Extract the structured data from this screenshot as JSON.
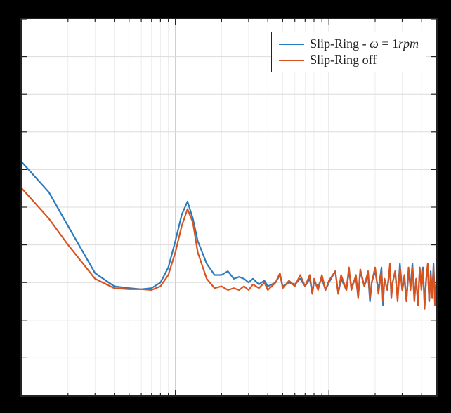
{
  "chart_data": {
    "type": "line",
    "xlabel": "",
    "ylabel": "",
    "xscale": "log",
    "xlim": [
      1,
      500
    ],
    "ylim": [
      0,
      100
    ],
    "grid": true,
    "x_gridlines": [
      1,
      10,
      100,
      500
    ],
    "x_minor_gridlines": [
      2,
      3,
      4,
      5,
      6,
      7,
      8,
      9,
      20,
      30,
      40,
      50,
      60,
      70,
      80,
      90,
      200,
      300,
      400
    ],
    "y_gridlines": [
      0,
      10,
      20,
      30,
      40,
      50,
      60,
      70,
      80,
      90,
      100
    ],
    "legend_position": "upper right",
    "series": [
      {
        "name": "Slip-Ring - ω = 1rpm",
        "color": "#2A7BBE",
        "points": [
          [
            1,
            62
          ],
          [
            1.5,
            54
          ],
          [
            2,
            45
          ],
          [
            3,
            32.5
          ],
          [
            4,
            29
          ],
          [
            5,
            28.5
          ],
          [
            6,
            28.2
          ],
          [
            7,
            28.5
          ],
          [
            8,
            30
          ],
          [
            9,
            34
          ],
          [
            10,
            41
          ],
          [
            11,
            48
          ],
          [
            12,
            51.5
          ],
          [
            13,
            47
          ],
          [
            14,
            41
          ],
          [
            16,
            35
          ],
          [
            18,
            32
          ],
          [
            20,
            32
          ],
          [
            22,
            33
          ],
          [
            24,
            31
          ],
          [
            26,
            31.5
          ],
          [
            28,
            31
          ],
          [
            30,
            30
          ],
          [
            32,
            31
          ],
          [
            35,
            29.5
          ],
          [
            38,
            30.5
          ],
          [
            40,
            29
          ],
          [
            45,
            30
          ],
          [
            48,
            32
          ],
          [
            50,
            29
          ],
          [
            55,
            30
          ],
          [
            60,
            29.5
          ],
          [
            65,
            31
          ],
          [
            70,
            29
          ],
          [
            75,
            31
          ],
          [
            78,
            27
          ],
          [
            80,
            30
          ],
          [
            85,
            29
          ],
          [
            90,
            31
          ],
          [
            95,
            28
          ],
          [
            100,
            30
          ],
          [
            110,
            33
          ],
          [
            115,
            27
          ],
          [
            120,
            31
          ],
          [
            130,
            28
          ],
          [
            135,
            33
          ],
          [
            140,
            29
          ],
          [
            150,
            31
          ],
          [
            155,
            26
          ],
          [
            160,
            33
          ],
          [
            170,
            29
          ],
          [
            180,
            32
          ],
          [
            185,
            25
          ],
          [
            190,
            30
          ],
          [
            200,
            33
          ],
          [
            210,
            28
          ],
          [
            220,
            34
          ],
          [
            225,
            24
          ],
          [
            230,
            31
          ],
          [
            240,
            28
          ],
          [
            250,
            34
          ],
          [
            255,
            26
          ],
          [
            260,
            30
          ],
          [
            270,
            33
          ],
          [
            280,
            26
          ],
          [
            290,
            35
          ],
          [
            300,
            28
          ],
          [
            310,
            31
          ],
          [
            320,
            25
          ],
          [
            330,
            33
          ],
          [
            340,
            29
          ],
          [
            350,
            35
          ],
          [
            360,
            26
          ],
          [
            370,
            31
          ],
          [
            380,
            24
          ],
          [
            390,
            34
          ],
          [
            400,
            29
          ],
          [
            410,
            34
          ],
          [
            420,
            24
          ],
          [
            430,
            31
          ],
          [
            440,
            34
          ],
          [
            450,
            25
          ],
          [
            460,
            33
          ],
          [
            470,
            27
          ],
          [
            480,
            35
          ],
          [
            490,
            25
          ],
          [
            500,
            30
          ]
        ]
      },
      {
        "name": "Slip-Ring off",
        "color": "#D9531E",
        "points": [
          [
            1,
            55
          ],
          [
            1.5,
            47
          ],
          [
            2,
            40
          ],
          [
            3,
            31
          ],
          [
            4,
            28.5
          ],
          [
            5,
            28.2
          ],
          [
            6,
            28.2
          ],
          [
            7,
            28
          ],
          [
            8,
            29
          ],
          [
            9,
            32
          ],
          [
            10,
            38
          ],
          [
            11,
            45
          ],
          [
            12,
            49.5
          ],
          [
            13,
            46
          ],
          [
            14,
            38
          ],
          [
            16,
            31
          ],
          [
            18,
            28.5
          ],
          [
            20,
            29
          ],
          [
            22,
            28
          ],
          [
            24,
            28.5
          ],
          [
            26,
            28
          ],
          [
            28,
            29
          ],
          [
            30,
            28
          ],
          [
            32,
            29.5
          ],
          [
            35,
            28.5
          ],
          [
            38,
            30
          ],
          [
            40,
            28
          ],
          [
            45,
            30
          ],
          [
            48,
            32.5
          ],
          [
            50,
            28.5
          ],
          [
            55,
            30.5
          ],
          [
            60,
            29
          ],
          [
            65,
            32
          ],
          [
            70,
            29
          ],
          [
            75,
            32
          ],
          [
            78,
            27
          ],
          [
            80,
            31
          ],
          [
            85,
            28
          ],
          [
            90,
            32
          ],
          [
            95,
            28
          ],
          [
            100,
            30.5
          ],
          [
            110,
            33
          ],
          [
            115,
            27
          ],
          [
            120,
            32
          ],
          [
            130,
            28
          ],
          [
            135,
            34
          ],
          [
            140,
            28
          ],
          [
            150,
            32
          ],
          [
            155,
            26
          ],
          [
            160,
            33.5
          ],
          [
            170,
            29
          ],
          [
            180,
            33
          ],
          [
            185,
            26
          ],
          [
            190,
            30
          ],
          [
            200,
            34
          ],
          [
            210,
            27
          ],
          [
            220,
            33
          ],
          [
            225,
            25
          ],
          [
            230,
            31
          ],
          [
            240,
            28
          ],
          [
            250,
            35
          ],
          [
            255,
            26
          ],
          [
            260,
            30
          ],
          [
            270,
            33
          ],
          [
            280,
            25
          ],
          [
            290,
            34
          ],
          [
            300,
            28
          ],
          [
            310,
            32
          ],
          [
            320,
            25
          ],
          [
            330,
            34
          ],
          [
            340,
            28
          ],
          [
            350,
            34
          ],
          [
            360,
            25
          ],
          [
            370,
            31
          ],
          [
            380,
            24
          ],
          [
            390,
            34
          ],
          [
            400,
            28
          ],
          [
            410,
            33
          ],
          [
            420,
            23
          ],
          [
            430,
            31
          ],
          [
            440,
            35
          ],
          [
            450,
            25
          ],
          [
            460,
            32
          ],
          [
            470,
            26
          ],
          [
            480,
            34
          ],
          [
            490,
            24
          ],
          [
            500,
            29
          ]
        ]
      }
    ]
  },
  "legend": {
    "items": [
      {
        "label_html": "Slip-Ring - <i>ω</i> = 1<i>rpm</i>",
        "color": "#2A7BBE"
      },
      {
        "label_html": "Slip-Ring off",
        "color": "#D9531E"
      }
    ]
  }
}
